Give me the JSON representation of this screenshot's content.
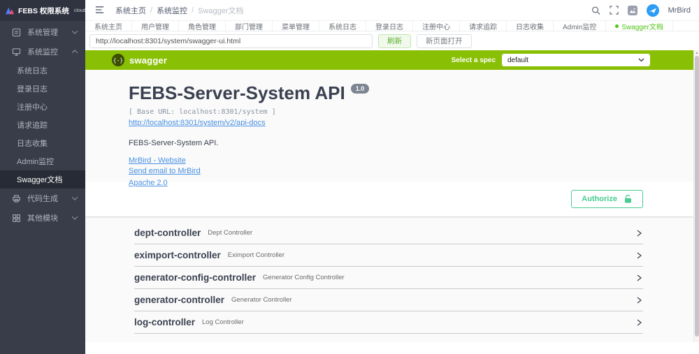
{
  "logo": {
    "title": "FEBS 权限系统",
    "suffix": "cloud"
  },
  "sidebar": {
    "items": [
      {
        "label": "系统管理"
      },
      {
        "label": "系统监控",
        "children": [
          "系统日志",
          "登录日志",
          "注册中心",
          "请求追踪",
          "日志收集",
          "Admin监控",
          "Swagger文档"
        ],
        "active_child": "Swagger文档"
      },
      {
        "label": "代码生成"
      },
      {
        "label": "其他模块"
      }
    ]
  },
  "topbar": {
    "breadcrumb": [
      "系统主页",
      "系统监控",
      "Swagger文档"
    ],
    "username": "MrBird"
  },
  "tabs": [
    "系统主页",
    "用户管理",
    "角色管理",
    "部门管理",
    "菜单管理",
    "系统日志",
    "登录日志",
    "注册中心",
    "请求追踪",
    "日志收集",
    "Admin监控",
    "Swagger文档"
  ],
  "active_tab": "Swagger文档",
  "urlbar": {
    "url": "http://localhost:8301/system/swagger-ui.html",
    "refresh_label": "刷新",
    "open_label": "新页面打开"
  },
  "swagger": {
    "brand": "swagger",
    "logo_glyph": "{-}",
    "select_spec_label": "Select a spec",
    "spec_selected": "default",
    "title": "FEBS-Server-System API",
    "version": "1.0",
    "base_url": "[ Base URL: localhost:8301/system ]",
    "api_docs_link": "http://localhost:8301/system/v2/api-docs",
    "description": "FEBS-Server-System API.",
    "links": [
      "MrBird - Website",
      "Send email to MrBird",
      "Apache 2.0"
    ],
    "authorize_label": "Authorize",
    "controllers": [
      {
        "name": "dept-controller",
        "desc": "Dept Controller"
      },
      {
        "name": "eximport-controller",
        "desc": "Eximport Controller"
      },
      {
        "name": "generator-config-controller",
        "desc": "Generator Config Controller"
      },
      {
        "name": "generator-controller",
        "desc": "Generator Controller"
      },
      {
        "name": "log-controller",
        "desc": "Log Controller"
      }
    ]
  },
  "colors": {
    "sidebar_bg": "#393D49",
    "sidebar_active_bg": "#272B35",
    "swagger_green": "#89bf04",
    "authorize_green": "#49cc90",
    "accent_green": "#52c41a",
    "link_blue": "#4990e2",
    "avatar_blue": "#2d9cf4"
  }
}
